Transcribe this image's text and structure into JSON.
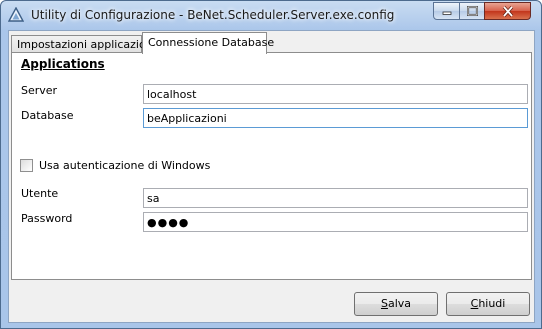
{
  "window": {
    "title": "Utility di Configurazione - BeNet.Scheduler.Server.exe.config"
  },
  "tabs": [
    {
      "label": "Impostazioni applicazione",
      "selected": false
    },
    {
      "label": "Connessione Database",
      "selected": true
    }
  ],
  "panel": {
    "section_title": "Applications",
    "server": {
      "label": "Server",
      "value": "localhost"
    },
    "database": {
      "label": "Database",
      "value": "beApplicazioni"
    },
    "windows_auth": {
      "label": "Usa autenticazione di Windows",
      "checked": false
    },
    "user": {
      "label": "Utente",
      "value": "sa"
    },
    "password": {
      "label": "Password",
      "value": "●●●●"
    }
  },
  "buttons": {
    "save": {
      "accel": "S",
      "rest": "alva"
    },
    "close": {
      "accel": "C",
      "rest": "hiudi"
    }
  },
  "icons": {
    "app": "app-config-icon",
    "minimize": "minimize-icon",
    "maximize": "maximize-icon",
    "close": "close-icon"
  }
}
